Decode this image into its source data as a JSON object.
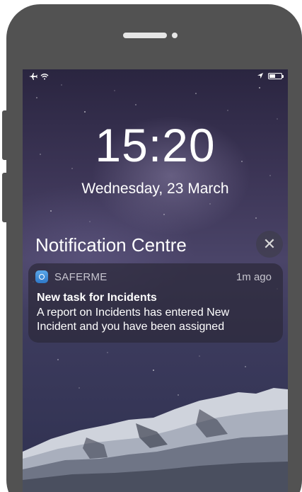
{
  "status_bar": {
    "left_icons": [
      "airplane-icon",
      "wifi-icon"
    ],
    "right_icons": [
      "location-arrow-icon",
      "battery-icon"
    ]
  },
  "lock_screen": {
    "time": "15:20",
    "date": "Wednesday, 23 March"
  },
  "notification_centre": {
    "title": "Notification Centre",
    "close_icon": "close-icon"
  },
  "notification": {
    "app_name": "SAFERME",
    "time_ago": "1m ago",
    "title": "New task for Incidents",
    "body": "A report on Incidents has entered New Incident and you have been assigned"
  },
  "colors": {
    "phone_frame": "#525252",
    "card_background": "#2d2a3a"
  }
}
